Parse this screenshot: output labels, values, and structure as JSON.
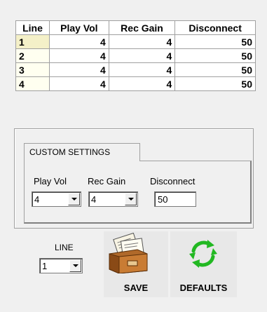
{
  "table": {
    "headers": [
      "Line",
      "Play Vol",
      "Rec Gain",
      "Disconnect"
    ],
    "rows": [
      {
        "line": "1",
        "play_vol": "4",
        "rec_gain": "4",
        "disconnect": "50"
      },
      {
        "line": "2",
        "play_vol": "4",
        "rec_gain": "4",
        "disconnect": "50"
      },
      {
        "line": "3",
        "play_vol": "4",
        "rec_gain": "4",
        "disconnect": "50"
      },
      {
        "line": "4",
        "play_vol": "4",
        "rec_gain": "4",
        "disconnect": "50"
      }
    ]
  },
  "custom_settings": {
    "tab_label": "CUSTOM SETTINGS",
    "play_vol_label": "Play Vol",
    "rec_gain_label": "Rec Gain",
    "disconnect_label": "Disconnect",
    "play_vol_value": "4",
    "rec_gain_value": "4",
    "disconnect_value": "50"
  },
  "controls": {
    "line_label": "LINE",
    "line_value": "1",
    "save_label": "SAVE",
    "defaults_label": "DEFAULTS",
    "save_icon": "card-file-icon",
    "defaults_icon": "refresh-icon"
  },
  "colors": {
    "background": "#f0f0f0",
    "refresh_green": "#22b822"
  }
}
